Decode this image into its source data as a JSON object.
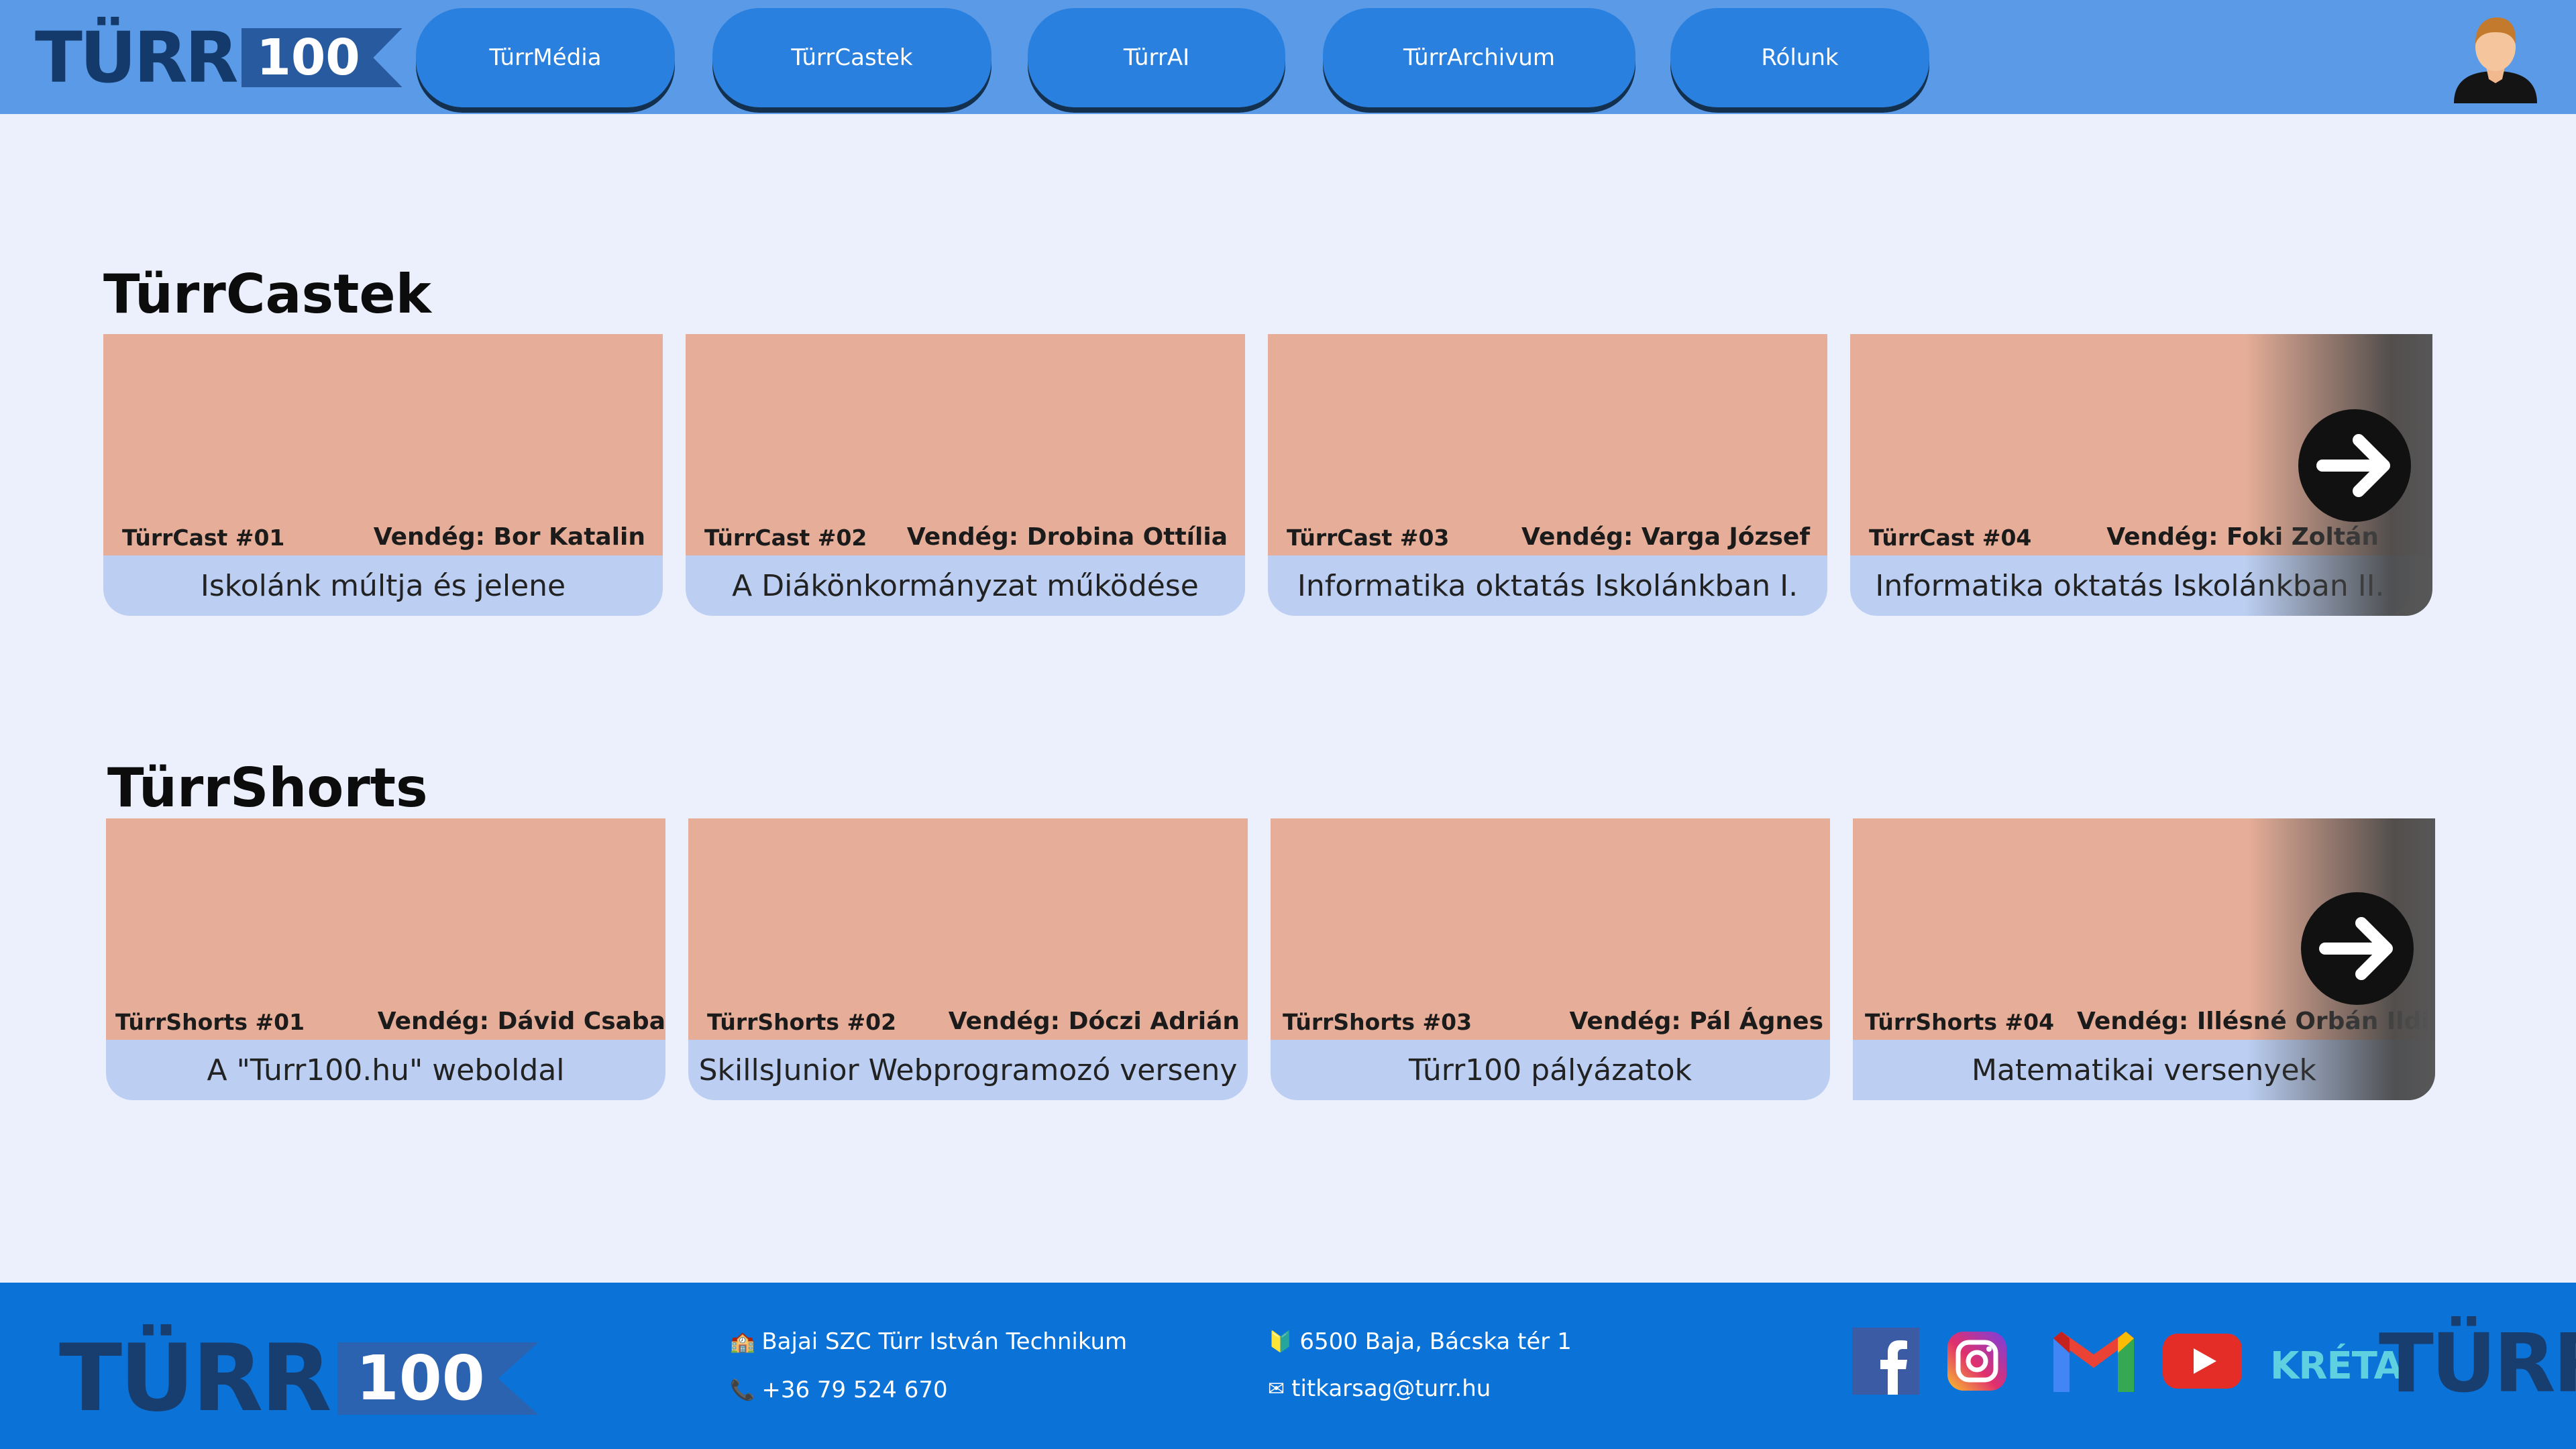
{
  "header": {
    "logo": {
      "word": "TÜRR",
      "number": "100"
    },
    "nav": [
      "TürrMédia",
      "TürrCastek",
      "TürrAI",
      "TürrArchivum",
      "Rólunk"
    ]
  },
  "sections": [
    {
      "title": "TürrCastek",
      "cards": [
        {
          "ep": "TürrCast #01",
          "guest": "Vendég: Bor Katalin",
          "caption": "Iskolánk múltja és jelene"
        },
        {
          "ep": "TürrCast #02",
          "guest": "Vendég: Drobina Ottília",
          "caption": "A Diákönkormányzat működése"
        },
        {
          "ep": "TürrCast #03",
          "guest": "Vendég: Varga József",
          "caption": "Informatika oktatás Iskolánkban I."
        },
        {
          "ep": "TürrCast #04",
          "guest": "Vendég: Foki Zoltán",
          "caption": "Informatika oktatás Iskolánkban II."
        }
      ]
    },
    {
      "title": "TürrShorts",
      "cards": [
        {
          "ep": "TürrShorts #01",
          "guest": "Vendég: Dávid Csaba",
          "caption": "A \"Turr100.hu\" weboldal"
        },
        {
          "ep": "TürrShorts #02",
          "guest": "Vendég: Dóczi Adrián",
          "caption": "SkillsJunior Webprogramozó verseny"
        },
        {
          "ep": "TürrShorts #03",
          "guest": "Vendég: Pál Ágnes",
          "caption": "Türr100 pályázatok"
        },
        {
          "ep": "TürrShorts #04",
          "guest": "Vendég: Illésné Orbán Ildikó",
          "caption": "Matematikai versenyek"
        }
      ]
    }
  ],
  "footer": {
    "logo": {
      "word": "TÜRR",
      "number": "100"
    },
    "school": "Bajai SZC Türr István Technikum",
    "phone": "+36 79 524 670",
    "address": "6500 Baja, Bácska tér 1",
    "email": "titkarsag@turr.hu",
    "socials": [
      "facebook-icon",
      "instagram-icon",
      "gmail-icon",
      "youtube-icon"
    ],
    "kreta": "KRÉTA",
    "turr": "TÜRR"
  },
  "colors": {
    "header_bg": "#5b9ae6",
    "nav_button": "#2a80de",
    "page_bg": "#ecf0fd",
    "thumb": "#e6ae98",
    "caption_bg": "#bccff2",
    "footer_bg": "#0b72d8"
  }
}
